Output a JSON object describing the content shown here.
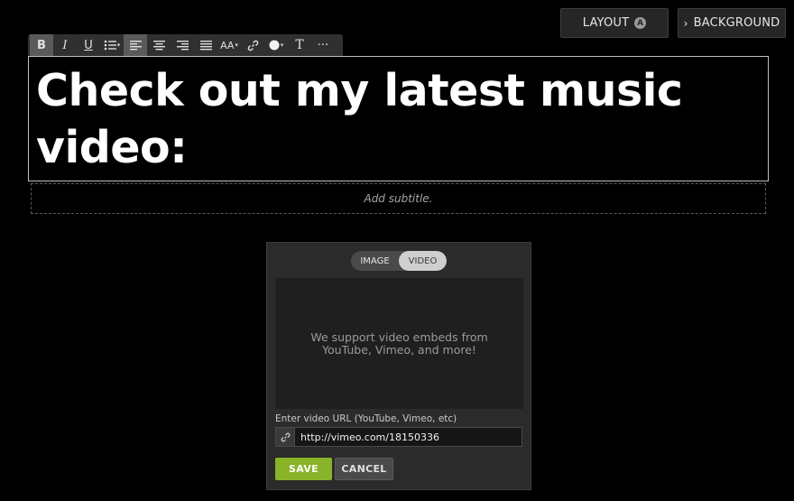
{
  "header": {
    "layout_label": "LAYOUT",
    "layout_badge": "A",
    "background_chevron": "›",
    "background_label": "BACKGROUND"
  },
  "toolbar": {
    "bold": "B",
    "italic": "I",
    "underline": "U",
    "font_size": "AA",
    "text_format": "T",
    "more": "···",
    "dropdown_caret": "▾"
  },
  "editor": {
    "title": "Check out my latest music video:",
    "subtitle_placeholder": "Add subtitle."
  },
  "media_panel": {
    "tabs": [
      "IMAGE",
      "VIDEO"
    ],
    "selected_tab": "VIDEO",
    "preview_text": "We support video embeds from YouTube, Vimeo, and more!",
    "url_label": "Enter video URL (YouTube, Vimeo, etc)",
    "url_value": "http://vimeo.com/18150336",
    "save_label": "SAVE",
    "cancel_label": "CANCEL"
  },
  "colors": {
    "background": "#000000",
    "save_button": "#89b328",
    "panel": "#2b2b2b"
  }
}
